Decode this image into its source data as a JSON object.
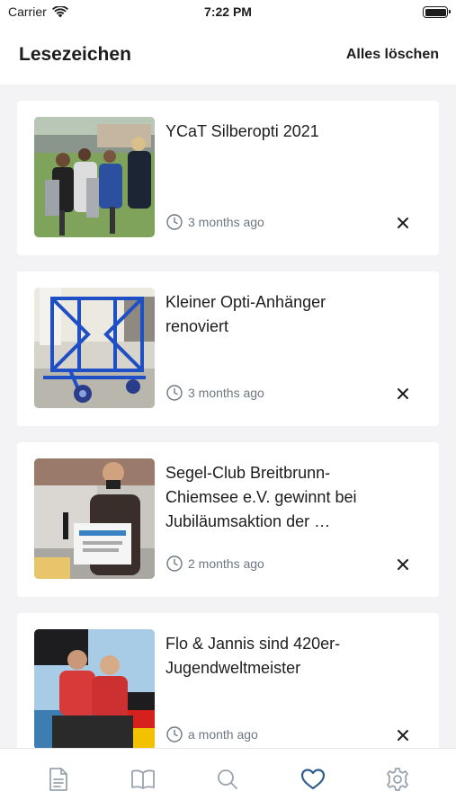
{
  "status_bar": {
    "carrier": "Carrier",
    "time": "7:22 PM"
  },
  "header": {
    "title": "Lesezeichen",
    "clear_all_label": "Alles löschen"
  },
  "bookmarks": [
    {
      "title": "YCaT Silberopti 2021",
      "age": "3 months ago"
    },
    {
      "title": "Kleiner Opti-Anhänger renoviert",
      "age": "3 months ago"
    },
    {
      "title": "Segel-Club Breitbrunn-Chiemsee e.V. gewinnt bei Jubiläumsaktion der …",
      "age": "2 months ago"
    },
    {
      "title": "Flo & Jannis sind 420er-Jugendweltmeister",
      "age": "a month ago"
    }
  ],
  "tabs": [
    {
      "icon": "document-icon",
      "active": false
    },
    {
      "icon": "book-icon",
      "active": false
    },
    {
      "icon": "search-icon",
      "active": false
    },
    {
      "icon": "heart-icon",
      "active": true
    },
    {
      "icon": "gear-icon",
      "active": false
    }
  ],
  "colors": {
    "accent": "#2f5c8f",
    "inactive_icon": "#9aa3ad",
    "meta_text": "#6e7780"
  }
}
